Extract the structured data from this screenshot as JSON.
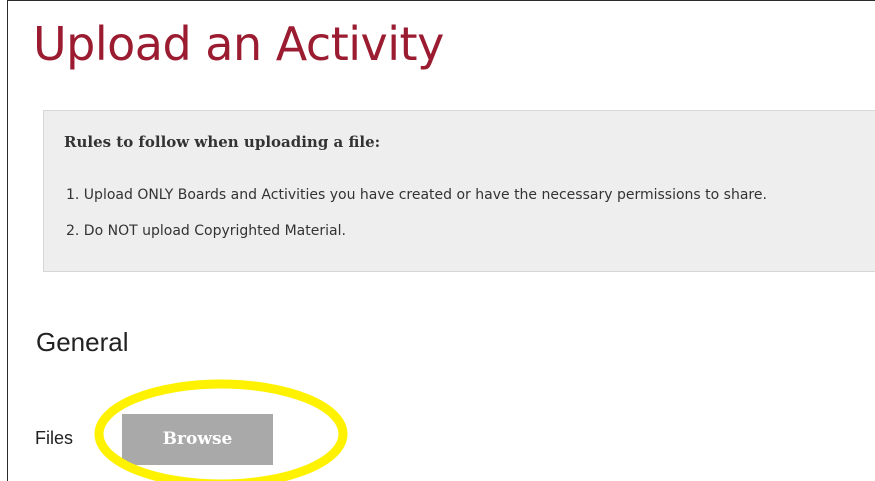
{
  "page": {
    "title": "Upload an Activity"
  },
  "rules": {
    "heading": "Rules to follow when uploading a file:",
    "items": [
      "1. Upload ONLY Boards and Activities you have created or have the necessary permissions to share.",
      "2. Do NOT upload Copyrighted Material."
    ]
  },
  "general": {
    "heading": "General",
    "files_label": "Files",
    "required_marker": "*",
    "browse_label": "Browse"
  },
  "colors": {
    "title": "#9b1b30",
    "rules_background": "#eeeeee",
    "browse_button": "#a9a9a9",
    "required_marker": "#e21a1a",
    "highlight": "#fff200"
  }
}
